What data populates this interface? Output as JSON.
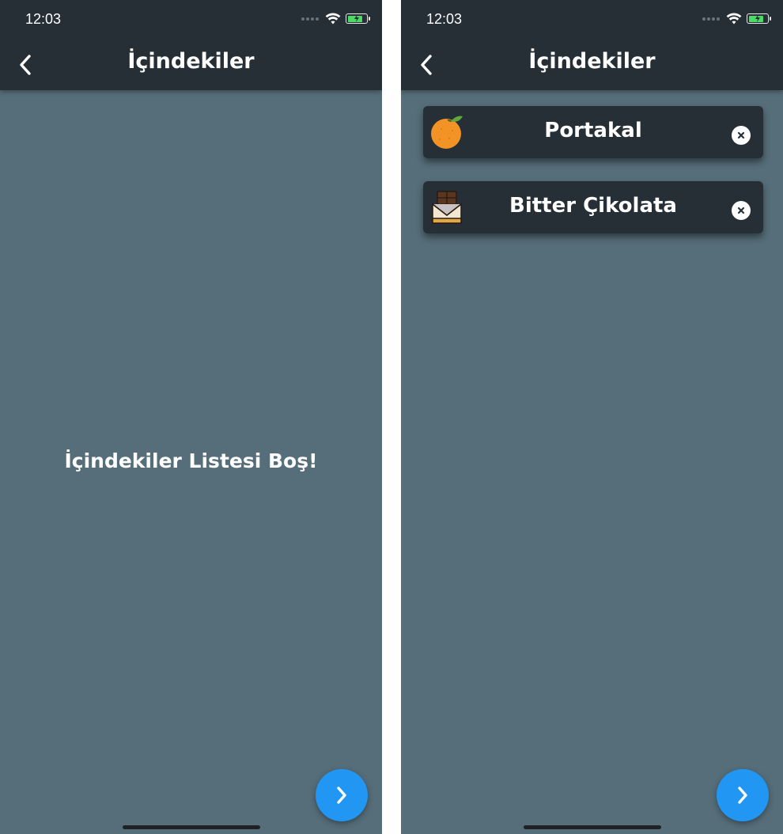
{
  "status_bar": {
    "time": "12:03"
  },
  "header": {
    "title": "İçindekiler"
  },
  "empty_screen": {
    "message": "İçindekiler Listesi Boş!"
  },
  "ingredients": [
    {
      "name": "Portakal",
      "icon": "orange-icon"
    },
    {
      "name": "Bitter Çikolata",
      "icon": "dark-chocolate-icon"
    }
  ],
  "colors": {
    "header_bg": "#262f36",
    "body_bg": "#566e7a",
    "card_bg": "#262f36",
    "fab_bg": "#2196f3",
    "battery": "#4cd964"
  }
}
